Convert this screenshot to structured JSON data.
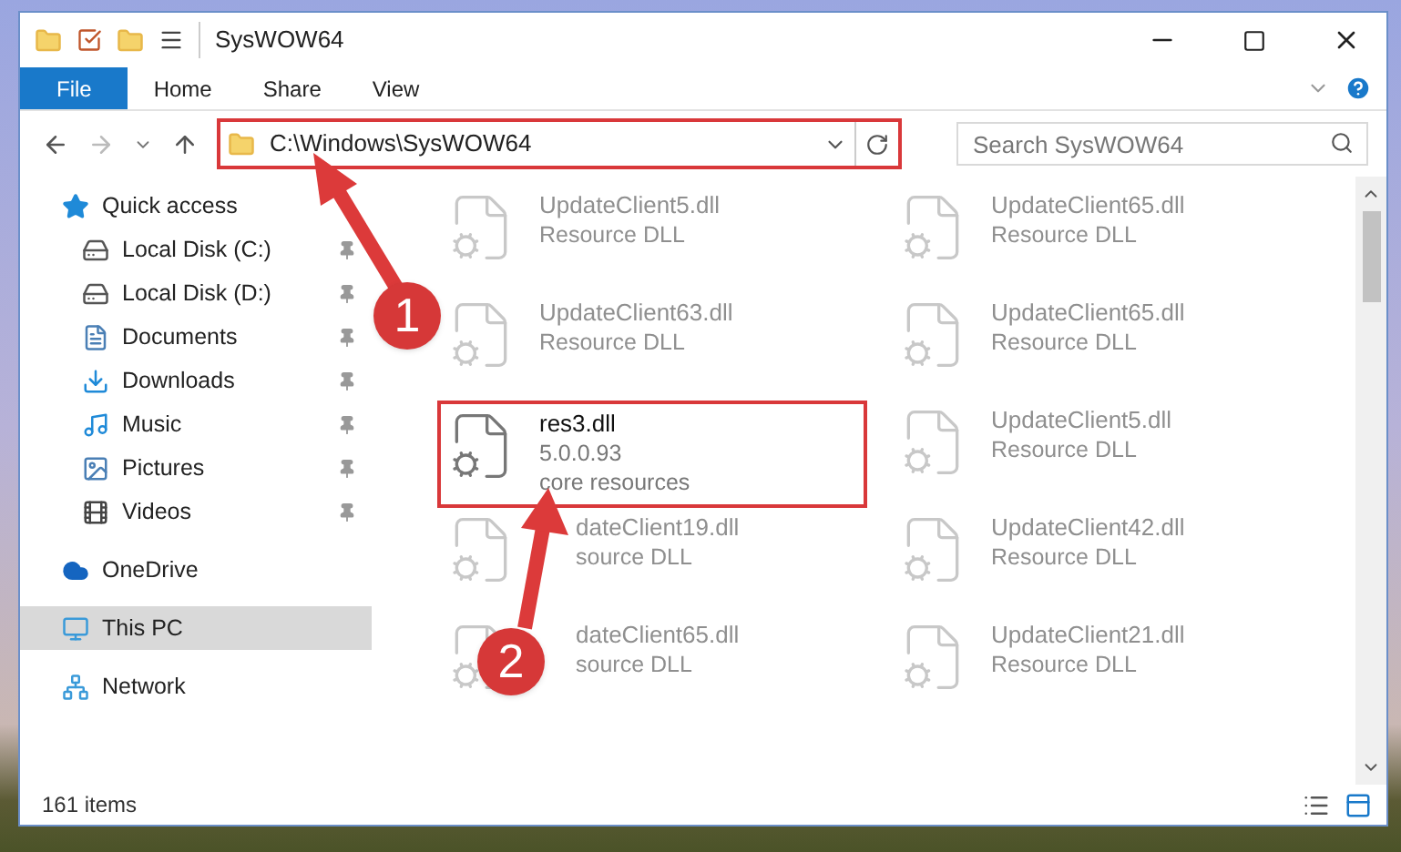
{
  "window": {
    "title": "SysWOW64"
  },
  "ribbon_tabs": [
    {
      "label": "File",
      "kind": "file"
    },
    {
      "label": "Home",
      "kind": "tab"
    },
    {
      "label": "Share",
      "kind": "tab"
    },
    {
      "label": "View",
      "kind": "tab"
    }
  ],
  "address_bar": {
    "path": "C:\\Windows\\SysWOW64",
    "highlighted": true
  },
  "search": {
    "placeholder": "Search SysWOW64"
  },
  "sidebar": {
    "items": [
      {
        "label": "Quick access",
        "kind": "star",
        "pinned": false,
        "selected": false,
        "children": [
          {
            "label": "Local Disk (C:)",
            "kind": "disk",
            "pinned": true,
            "selected": false
          },
          {
            "label": "Local Disk (D:)",
            "kind": "disk",
            "pinned": true,
            "selected": false
          },
          {
            "label": "Documents",
            "kind": "documents",
            "pinned": true,
            "selected": false
          },
          {
            "label": "Downloads",
            "kind": "downloads",
            "pinned": true,
            "selected": false
          },
          {
            "label": "Music",
            "kind": "music",
            "pinned": true,
            "selected": false
          },
          {
            "label": "Pictures",
            "kind": "pictures",
            "pinned": true,
            "selected": false
          },
          {
            "label": "Videos",
            "kind": "videos",
            "pinned": true,
            "selected": false
          }
        ]
      },
      {
        "label": "OneDrive",
        "kind": "cloud",
        "pinned": false,
        "selected": false
      },
      {
        "label": "This PC",
        "kind": "pc",
        "pinned": false,
        "selected": true
      },
      {
        "label": "Network",
        "kind": "network",
        "pinned": false,
        "selected": false
      }
    ]
  },
  "files": [
    {
      "name": "UpdateClient5.dll",
      "lines": [
        "Resource DLL"
      ],
      "dimmed": true,
      "highlighted": false,
      "partly_covered": false
    },
    {
      "name": "UpdateClient65.dll",
      "lines": [
        "Resource DLL"
      ],
      "dimmed": true,
      "highlighted": false,
      "partly_covered": false
    },
    {
      "name": "UpdateClient63.dll",
      "lines": [
        "Resource DLL"
      ],
      "dimmed": true,
      "highlighted": false,
      "partly_covered": false
    },
    {
      "name": "UpdateClient65.dll",
      "lines": [
        "Resource DLL"
      ],
      "dimmed": true,
      "highlighted": false,
      "partly_covered": false
    },
    {
      "name": "res3.dll",
      "lines": [
        "5.0.0.93",
        "core resources"
      ],
      "dimmed": false,
      "highlighted": true,
      "partly_covered": false
    },
    {
      "name": "UpdateClient5.dll",
      "lines": [
        "Resource DLL"
      ],
      "dimmed": true,
      "highlighted": false,
      "partly_covered": false
    },
    {
      "name": "dateClient19.dll",
      "lines": [
        "source DLL"
      ],
      "dimmed": true,
      "highlighted": false,
      "partly_covered": true
    },
    {
      "name": "UpdateClient42.dll",
      "lines": [
        "Resource DLL"
      ],
      "dimmed": true,
      "highlighted": false,
      "partly_covered": false
    },
    {
      "name": "dateClient65.dll",
      "lines": [
        "source DLL"
      ],
      "dimmed": true,
      "highlighted": false,
      "partly_covered": true
    },
    {
      "name": "UpdateClient21.dll",
      "lines": [
        "Resource DLL"
      ],
      "dimmed": true,
      "highlighted": false,
      "partly_covered": false
    }
  ],
  "status_bar": {
    "text": "161 items"
  },
  "annotations": [
    {
      "number": "1"
    },
    {
      "number": "2"
    }
  ]
}
